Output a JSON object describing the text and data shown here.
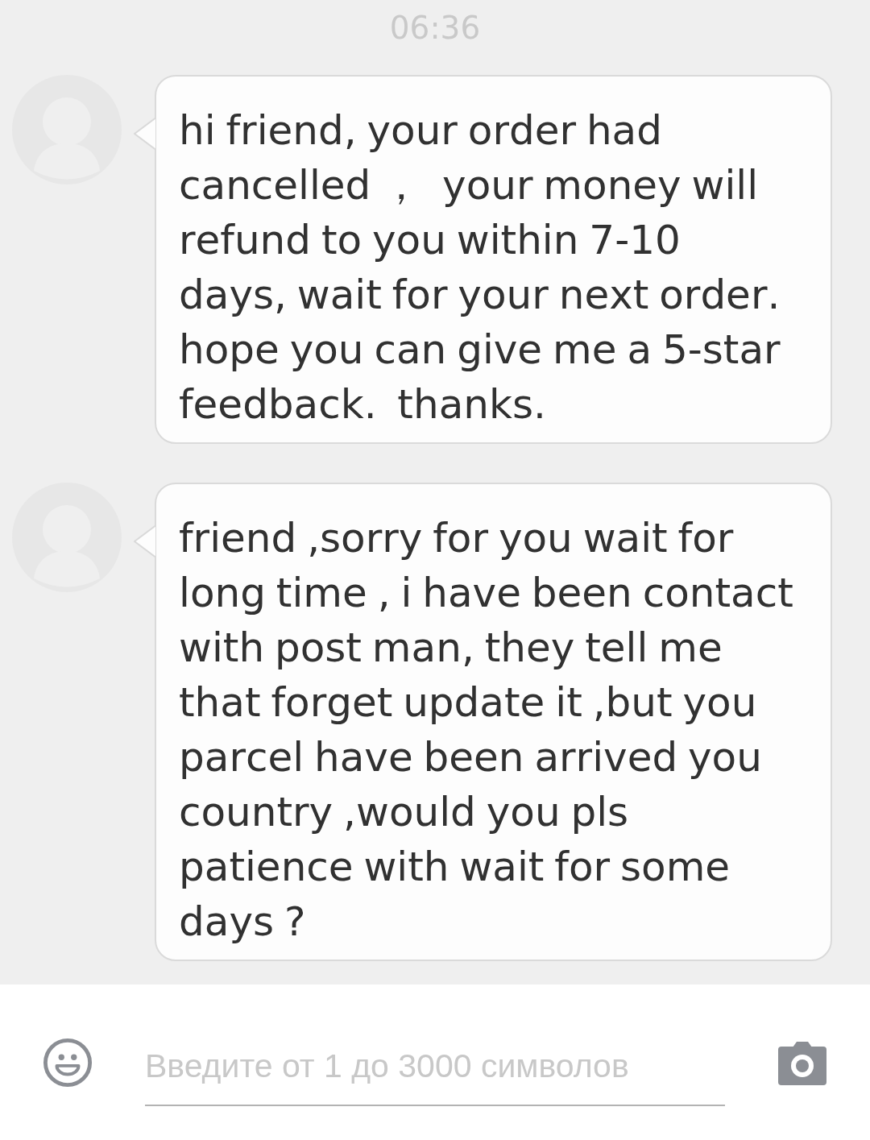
{
  "time": "06:36",
  "messages": [
    {
      "text": "hi friend, your order had cancelled ，  your money will refund to you within 7-10 days, wait for your next order. hope you can give me a 5-star feedback.  thanks."
    },
    {
      "text": "friend ,sorry for you wait for long time , i have been contact with post man, they tell me that forget update it ,but you parcel have been arrived you country ,would you pls patience with wait for some days ?"
    }
  ],
  "composer": {
    "placeholder": "Введите от 1 до 3000 символов"
  }
}
